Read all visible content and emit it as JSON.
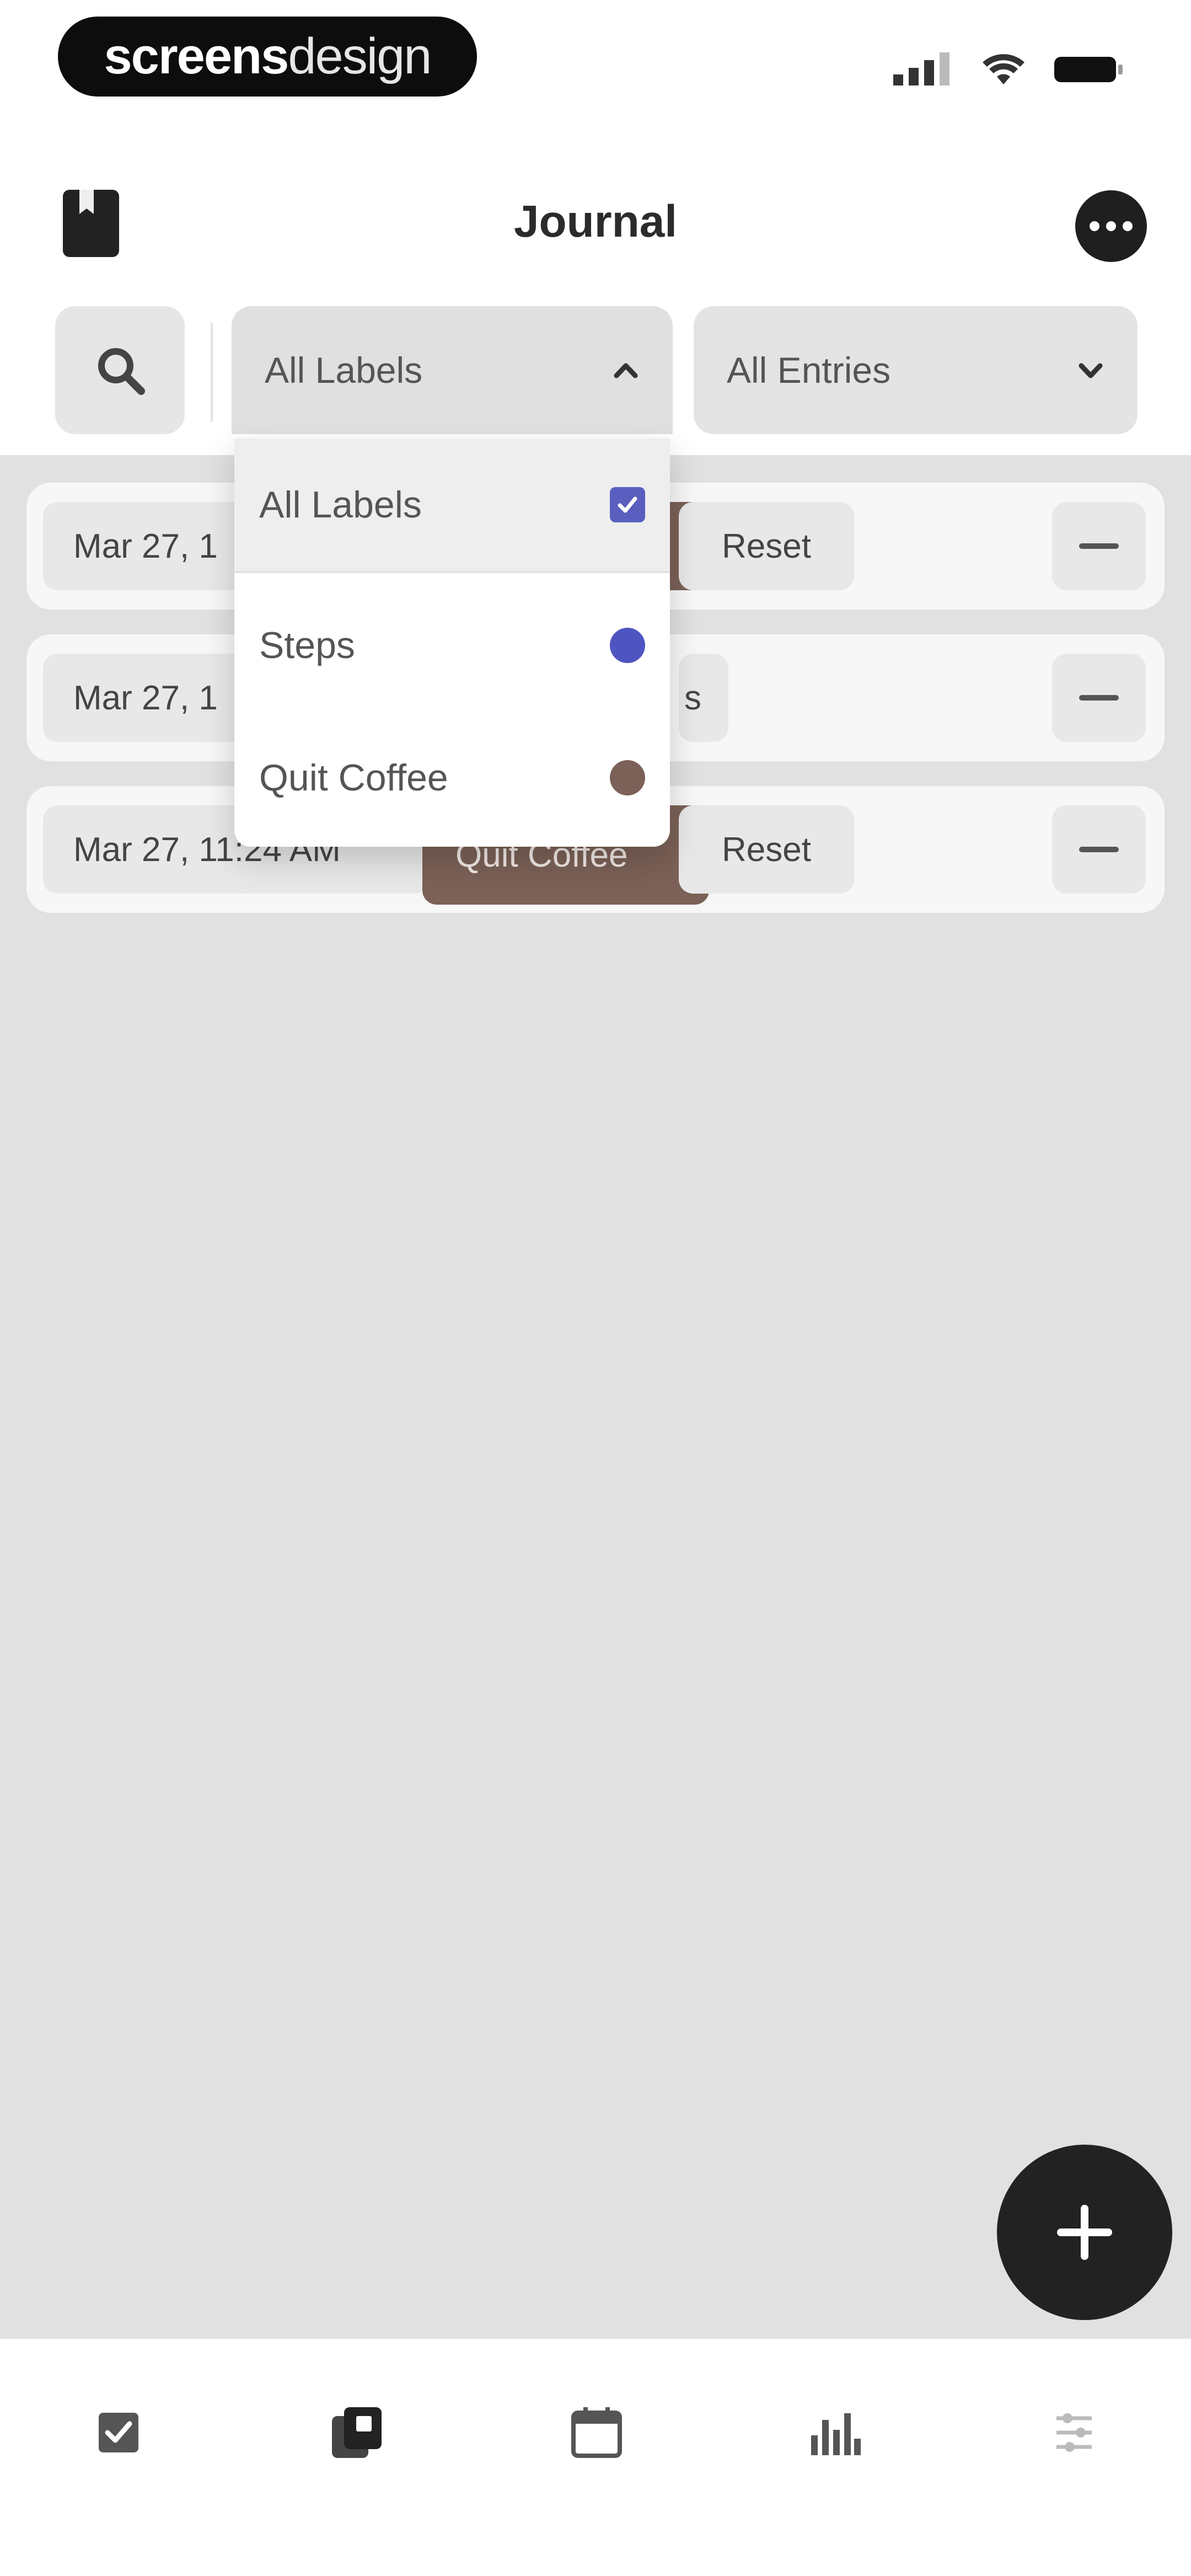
{
  "status_bar": {
    "brand_bold": "screens",
    "brand_light": "design",
    "icons": [
      "signal-icon",
      "wifi-icon",
      "battery-icon"
    ]
  },
  "header": {
    "title": "Journal",
    "left_icon": "journal-book-icon",
    "right_icon": "more-icon"
  },
  "filters": {
    "search_icon": "search-icon",
    "labels_select": {
      "value": "All Labels",
      "icon": "chevron-up-icon"
    },
    "entries_select": {
      "value": "All Entries",
      "icon": "chevron-down-icon"
    }
  },
  "entries": [
    {
      "date": "Mar 27, 1",
      "label": "",
      "action": "Reset"
    },
    {
      "date": "Mar 27, 1",
      "label": "s",
      "action": ""
    },
    {
      "date": "Mar 27, 11:24 AM",
      "label": "Quit Coffee",
      "action": "Reset"
    }
  ],
  "dropdown": {
    "options": [
      {
        "label": "All Labels",
        "indicator": "checkbox",
        "checked": true,
        "color": "#5a5fbf"
      },
      {
        "label": "Steps",
        "indicator": "dot",
        "color": "#4f55c0"
      },
      {
        "label": "Quit Coffee",
        "indicator": "dot",
        "color": "#7b6157"
      }
    ]
  },
  "fab": {
    "icon": "plus-icon"
  },
  "tabbar": {
    "items": [
      "tasks-icon",
      "journal-icon",
      "calendar-icon",
      "stats-icon",
      "settings-icon"
    ]
  },
  "colors": {
    "accent": "#5a5fbf",
    "quit_coffee": "#7b6157",
    "background": "#e1e1e1"
  }
}
